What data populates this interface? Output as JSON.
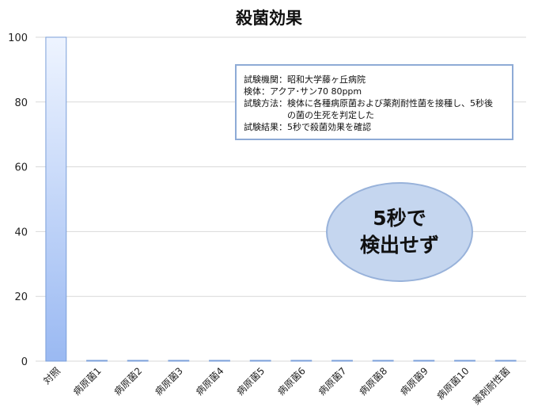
{
  "chart_data": {
    "type": "bar",
    "title": "殺菌効果",
    "categories": [
      "対照",
      "病原菌1",
      "病原菌2",
      "病原菌3",
      "病原菌4",
      "病原菌5",
      "病原菌6",
      "病原菌7",
      "病原菌8",
      "病原菌9",
      "病原菌10",
      "薬剤耐性菌"
    ],
    "values": [
      100,
      0,
      0,
      0,
      0,
      0,
      0,
      0,
      0,
      0,
      0,
      0
    ],
    "yticks": [
      0,
      20,
      40,
      60,
      80,
      100
    ],
    "ylim": [
      0,
      100
    ],
    "grid": true,
    "xlabel": "",
    "ylabel": "",
    "bar_color_top": "#eef4ff",
    "bar_color_bottom": "#9ab9f2",
    "bar_stroke": "#7b9fd9"
  },
  "info_box": {
    "line1": "試験機関：昭和大学藤ヶ丘病院",
    "line2": "検体：アクア･サン70 80ppm",
    "line3": "試験方法：検体に各種病原菌および薬剤耐性菌を接種し、5秒後",
    "line4": "の菌の生死を判定した",
    "line5": "試験結果：5秒で殺菌効果を確認"
  },
  "callout": {
    "line1": "5秒で",
    "line2": "検出せず"
  }
}
